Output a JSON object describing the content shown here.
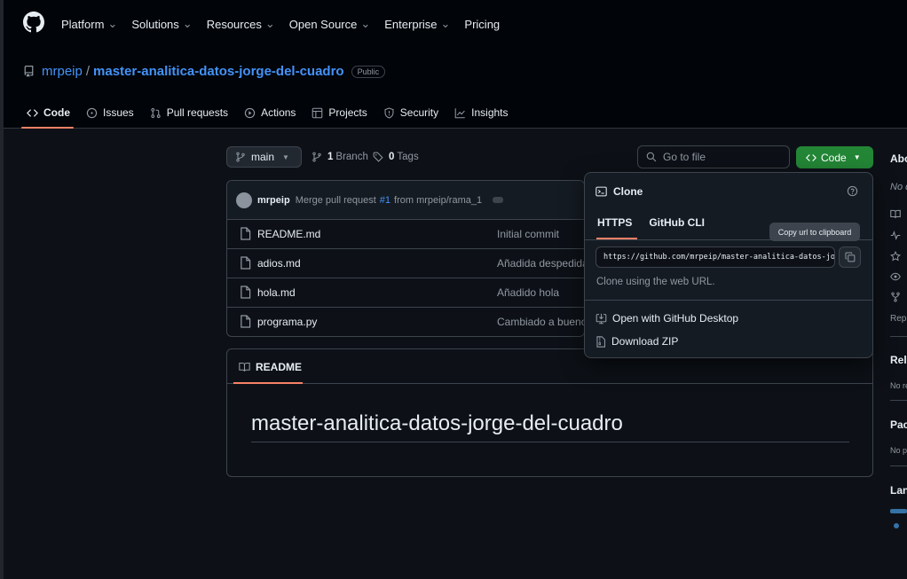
{
  "global_nav": {
    "items": [
      {
        "label": "Platform"
      },
      {
        "label": "Solutions"
      },
      {
        "label": "Resources"
      },
      {
        "label": "Open Source"
      },
      {
        "label": "Enterprise"
      },
      {
        "label": "Pricing"
      }
    ]
  },
  "repo": {
    "owner": "mrpeip",
    "separator": "/",
    "name": "master-analitica-datos-jorge-del-cuadro",
    "visibility": "Public"
  },
  "repo_tabs": [
    {
      "label": "Code"
    },
    {
      "label": "Issues"
    },
    {
      "label": "Pull requests"
    },
    {
      "label": "Actions"
    },
    {
      "label": "Projects"
    },
    {
      "label": "Security"
    },
    {
      "label": "Insights"
    }
  ],
  "branch_bar": {
    "branch": "main",
    "branch_count": "1",
    "branch_label": "Branch",
    "tag_count": "0",
    "tag_label": "Tags",
    "go_to_file_placeholder": "Go to file",
    "code_button": "Code"
  },
  "latest_commit": {
    "author": "mrpeip",
    "message_prefix": "Merge pull request",
    "pr_ref": "#1",
    "message_suffix": "from mrpeip/rama_1"
  },
  "files": [
    {
      "name": "README.md",
      "message": "Initial commit"
    },
    {
      "name": "adios.md",
      "message": "Añadida despedida"
    },
    {
      "name": "hola.md",
      "message": "Añadido hola"
    },
    {
      "name": "programa.py",
      "message": "Cambiado a buenos"
    }
  ],
  "readme": {
    "tab_label": "README",
    "heading": "master-analitica-datos-jorge-del-cuadro"
  },
  "clone": {
    "title": "Clone",
    "tabs": [
      {
        "label": "HTTPS"
      },
      {
        "label": "GitHub CLI"
      }
    ],
    "url": "https://github.com/mrpeip/master-analitica-datos-jorge-del-cuadro.git",
    "note": "Clone using the web URL.",
    "actions": [
      {
        "label": "Open with GitHub Desktop"
      },
      {
        "label": "Download ZIP"
      }
    ],
    "tooltip": "Copy url to clipboard"
  },
  "sidebar": {
    "about": "About",
    "about_text": "No description",
    "readme_label": "Readme",
    "releases": "Releases",
    "releases_text": "No releases",
    "packages": "Packages",
    "packages_text": "No packages",
    "languages": "Languages"
  },
  "colors": {
    "accent": "#f78166",
    "link": "#4493f8",
    "primary_button": "#238636"
  }
}
